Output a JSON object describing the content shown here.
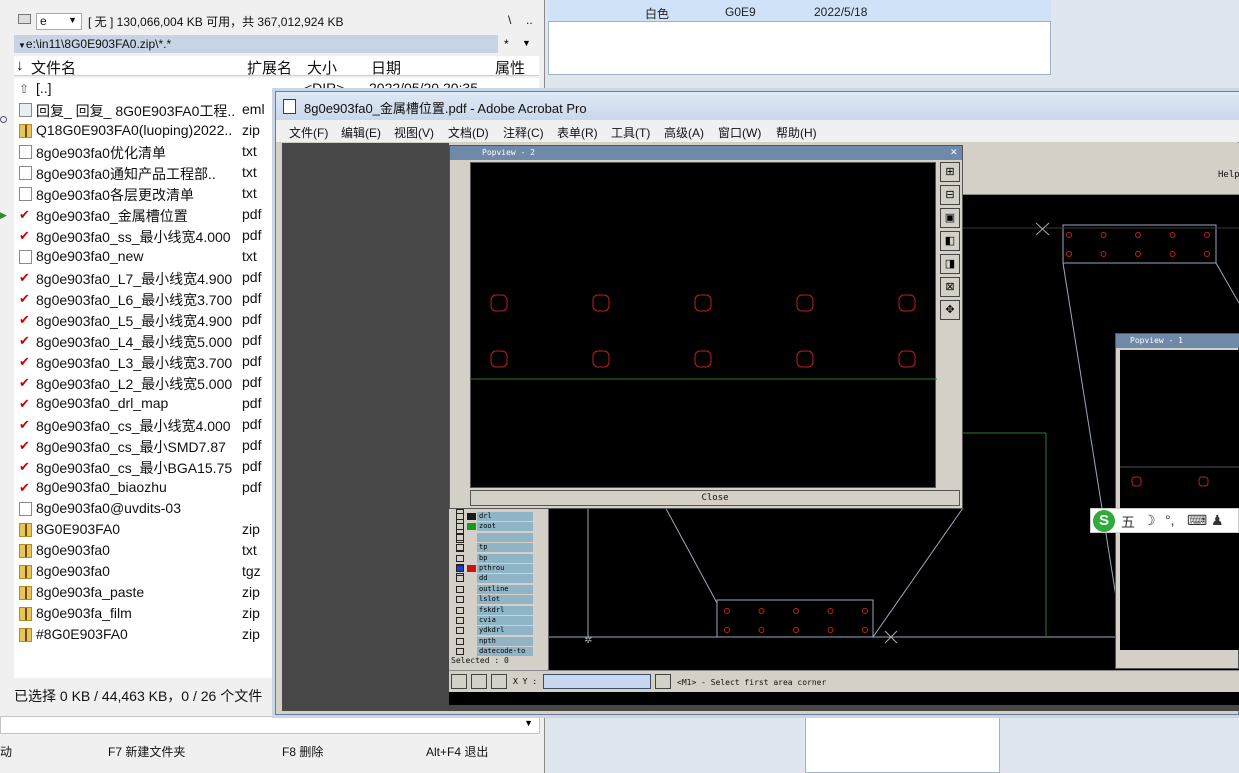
{
  "background": {
    "row": {
      "color": "白色",
      "code": "G0E9",
      "date": "2022/5/18"
    }
  },
  "filemanager": {
    "drive": "e",
    "drive_info": "[ 无 ] 130,066,004 KB 可用，共 367,012,924 KB",
    "drive_btns": [
      "\\",
      ".."
    ],
    "path": "e:\\in11\\8G0E903FA0.zip\\*.*",
    "path_btns": [
      "*",
      "▼"
    ],
    "headers": {
      "name": "文件名",
      "ext": "扩展名",
      "size": "大小",
      "date": "日期",
      "attr": "属性"
    },
    "up_row": {
      "name": "[..]",
      "size": "<DIR>",
      "date": "2022/05/20 20:35"
    },
    "files": [
      {
        "icon": "eml",
        "name": "回复_ 回复_ 8G0E903FA0工程..",
        "ext": "eml"
      },
      {
        "icon": "zip",
        "name": "Q18G0E903FA0(luoping)2022..",
        "ext": "zip"
      },
      {
        "icon": "txt",
        "name": "8g0e903fa0优化清单",
        "ext": "txt"
      },
      {
        "icon": "txt",
        "name": "8g0e903fa0通知产品工程部..",
        "ext": "txt"
      },
      {
        "icon": "txt",
        "name": "8g0e903fa0各层更改清单",
        "ext": "txt"
      },
      {
        "icon": "pdf",
        "name": "8g0e903fa0_金属槽位置",
        "ext": "pdf"
      },
      {
        "icon": "pdf",
        "name": "8g0e903fa0_ss_最小线宽4.000",
        "ext": "pdf"
      },
      {
        "icon": "txt",
        "name": "8g0e903fa0_new",
        "ext": "txt"
      },
      {
        "icon": "pdf",
        "name": "8g0e903fa0_L7_最小线宽4.900",
        "ext": "pdf"
      },
      {
        "icon": "pdf",
        "name": "8g0e903fa0_L6_最小线宽3.700",
        "ext": "pdf"
      },
      {
        "icon": "pdf",
        "name": "8g0e903fa0_L5_最小线宽4.900",
        "ext": "pdf"
      },
      {
        "icon": "pdf",
        "name": "8g0e903fa0_L4_最小线宽5.000",
        "ext": "pdf"
      },
      {
        "icon": "pdf",
        "name": "8g0e903fa0_L3_最小线宽3.700",
        "ext": "pdf"
      },
      {
        "icon": "pdf",
        "name": "8g0e903fa0_L2_最小线宽5.000",
        "ext": "pdf"
      },
      {
        "icon": "pdf",
        "name": "8g0e903fa0_drl_map",
        "ext": "pdf"
      },
      {
        "icon": "pdf",
        "name": "8g0e903fa0_cs_最小线宽4.000",
        "ext": "pdf"
      },
      {
        "icon": "pdf",
        "name": "8g0e903fa0_cs_最小SMD7.87",
        "ext": "pdf"
      },
      {
        "icon": "pdf",
        "name": "8g0e903fa0_cs_最小BGA15.75",
        "ext": "pdf"
      },
      {
        "icon": "pdf",
        "name": "8g0e903fa0_biaozhu",
        "ext": "pdf"
      },
      {
        "icon": "txt",
        "name": "8g0e903fa0@uvdits-03",
        "ext": ""
      },
      {
        "icon": "zip",
        "name": "8G0E903FA0",
        "ext": "zip"
      },
      {
        "icon": "zip",
        "name": "8g0e903fa0",
        "ext": "txt"
      },
      {
        "icon": "zip",
        "name": "8g0e903fa0",
        "ext": "tgz"
      },
      {
        "icon": "zip",
        "name": "8g0e903fa_paste",
        "ext": "zip"
      },
      {
        "icon": "zip",
        "name": "8g0e903fa_film",
        "ext": "zip"
      },
      {
        "icon": "zip",
        "name": "#8G0E903FA0",
        "ext": "zip"
      }
    ],
    "status": "已选择 0 KB / 44,463 KB，0 / 26 个文件",
    "fkeys": {
      "f_move": "动",
      "f7": "F7 新建文件夹",
      "f8": "F8 删除",
      "altf4": "Alt+F4 退出"
    }
  },
  "acrobat": {
    "title": "8g0e903fa0_金属槽位置.pdf - Adobe Acrobat Pro",
    "menu": [
      "文件(F)",
      "编辑(E)",
      "视图(V)",
      "文档(D)",
      "注释(C)",
      "表单(R)",
      "工具(T)",
      "高级(A)",
      "窗口(W)",
      "帮助(H)"
    ]
  },
  "cad": {
    "help": "Help",
    "layers": [
      {
        "name": "drl",
        "color": "#1a1a1a",
        "checked": false
      },
      {
        "name": "zoot",
        "color": "#1a9a1a",
        "checked": false
      },
      {
        "name": "",
        "color": "",
        "checked": false
      },
      {
        "name": "tp",
        "color": "",
        "checked": false
      },
      {
        "name": "bp",
        "color": "",
        "checked": false
      },
      {
        "name": "pthrou",
        "color": "#d01010",
        "checked": true
      },
      {
        "name": "dd",
        "color": "",
        "checked": false
      },
      {
        "name": "outline",
        "color": "",
        "checked": false
      },
      {
        "name": "lslot",
        "color": "",
        "checked": false
      },
      {
        "name": "fskdrl",
        "color": "",
        "checked": false
      },
      {
        "name": "cvia",
        "color": "",
        "checked": false
      },
      {
        "name": "ydkdrl",
        "color": "",
        "checked": false
      },
      {
        "name": "npth",
        "color": "",
        "checked": false
      },
      {
        "name": "datecode-to",
        "color": "",
        "checked": false
      }
    ],
    "selected": "Selected : 0",
    "xy_label": "X Y :",
    "status_msg": "<M1> - Select first area corner",
    "popview2": {
      "title": "Popview - 2",
      "close": "Close"
    },
    "popview1": {
      "title": "Popview - 1"
    }
  },
  "ime": {
    "logo": "S",
    "mode": "五"
  }
}
